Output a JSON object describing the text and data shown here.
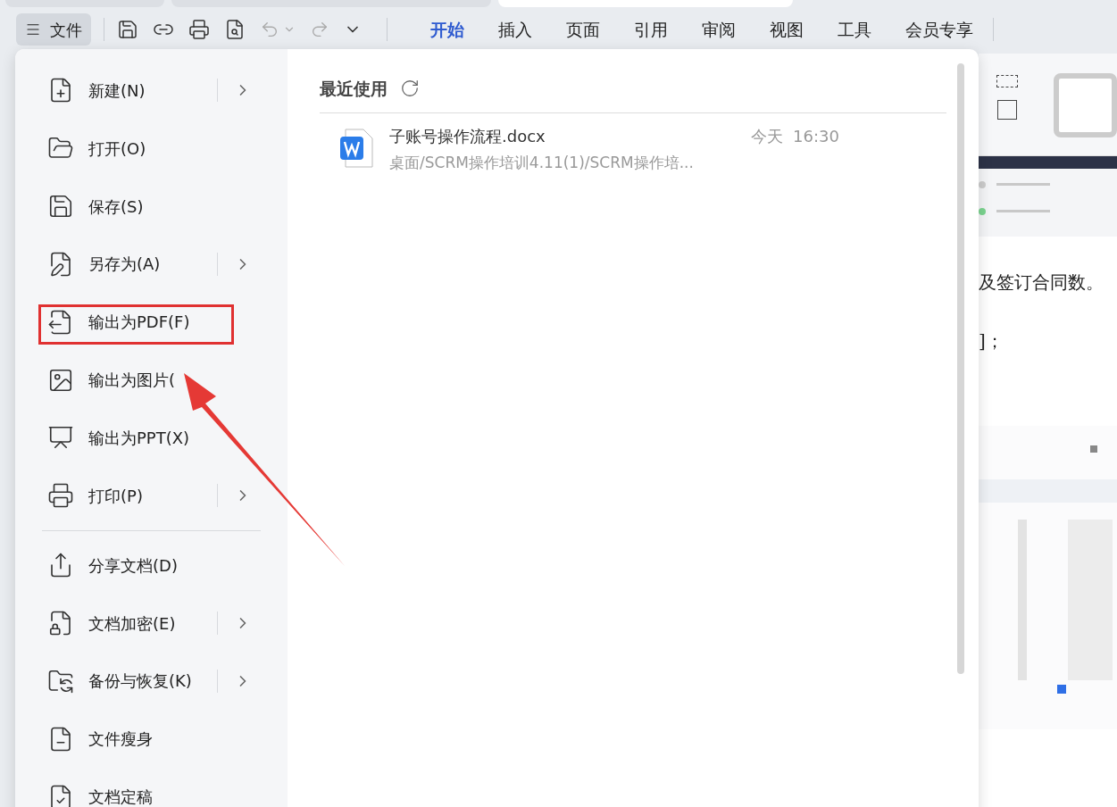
{
  "document_tabs": [
    {
      "selected": false
    },
    {
      "selected": false
    },
    {
      "selected": true
    }
  ],
  "toolbar": {
    "file_button": "文件",
    "tabs": [
      {
        "label": "开始",
        "selected": true
      },
      {
        "label": "插入",
        "selected": false
      },
      {
        "label": "页面",
        "selected": false
      },
      {
        "label": "引用",
        "selected": false
      },
      {
        "label": "审阅",
        "selected": false
      },
      {
        "label": "视图",
        "selected": false
      },
      {
        "label": "工具",
        "selected": false
      },
      {
        "label": "会员专享",
        "selected": false
      }
    ]
  },
  "file_menu": {
    "items": [
      {
        "kind": "item",
        "label": "新建(N)",
        "submenu": true,
        "highlighted": false
      },
      {
        "kind": "item",
        "label": "打开(O)",
        "submenu": false,
        "highlighted": false
      },
      {
        "kind": "item",
        "label": "保存(S)",
        "submenu": false,
        "highlighted": false
      },
      {
        "kind": "item",
        "label": "另存为(A)",
        "submenu": true,
        "highlighted": false
      },
      {
        "kind": "item",
        "label": "输出为PDF(F)",
        "submenu": false,
        "highlighted": true
      },
      {
        "kind": "item",
        "label": "输出为图片(",
        "submenu": false,
        "highlighted": false
      },
      {
        "kind": "item",
        "label": "输出为PPT(X)",
        "submenu": false,
        "highlighted": false
      },
      {
        "kind": "item",
        "label": "打印(P)",
        "submenu": true,
        "highlighted": false
      },
      {
        "kind": "divider"
      },
      {
        "kind": "item",
        "label": "分享文档(D)",
        "submenu": false,
        "highlighted": false
      },
      {
        "kind": "item",
        "label": "文档加密(E)",
        "submenu": true,
        "highlighted": false
      },
      {
        "kind": "item",
        "label": "备份与恢复(K)",
        "submenu": true,
        "highlighted": false
      },
      {
        "kind": "item",
        "label": "文件瘦身",
        "submenu": false,
        "highlighted": false
      },
      {
        "kind": "item",
        "label": "文档定稿",
        "submenu": false,
        "highlighted": false
      }
    ],
    "recent": {
      "title": "最近使用",
      "files": [
        {
          "name": "子账号操作流程.docx",
          "path": "桌面/SCRM操作培训4.11(1)/SCRM操作培...",
          "time": "今天  16:30"
        }
      ]
    }
  },
  "document": {
    "lines": [
      "及签订合同数。",
      "]；"
    ]
  }
}
